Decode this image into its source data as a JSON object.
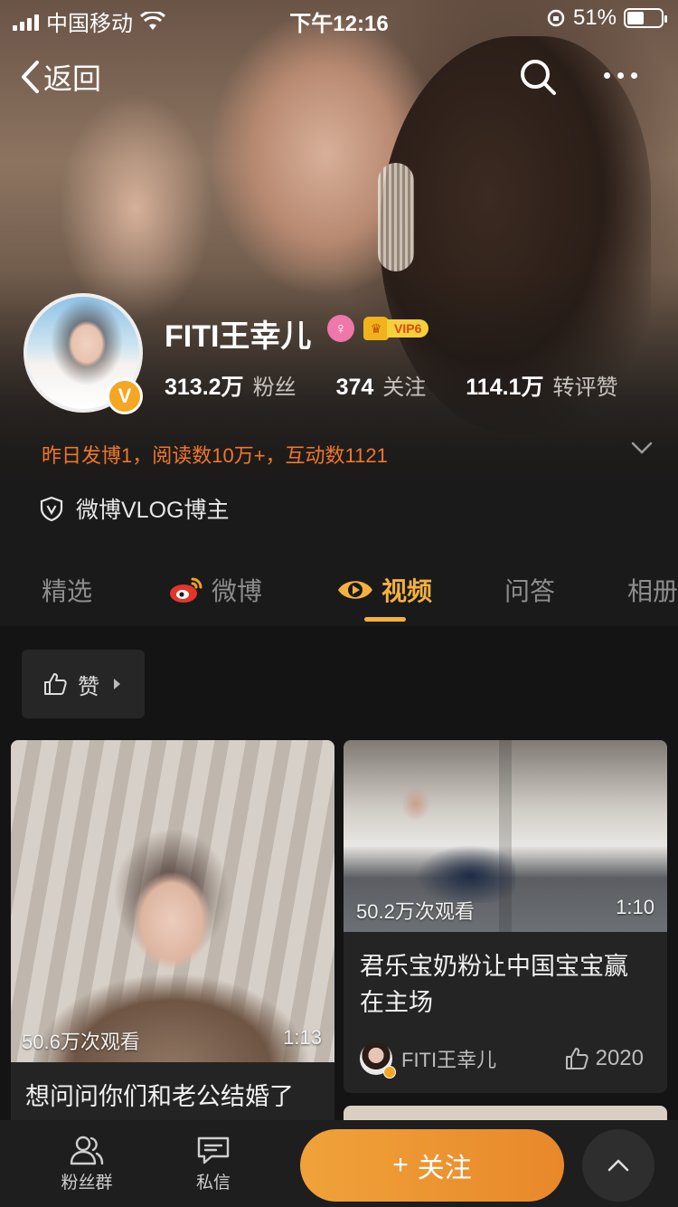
{
  "status_bar": {
    "carrier": "中国移动",
    "time": "下午12:16",
    "battery_percent": "51%",
    "battery_level": 0.51
  },
  "nav": {
    "back_label": "返回"
  },
  "profile": {
    "name": "FITI王幸儿",
    "vip_label": "VIP6",
    "verified_badge": "V",
    "stats": [
      {
        "value": "313.2万",
        "label": "粉丝"
      },
      {
        "value": "374",
        "label": "关注"
      },
      {
        "value": "114.1万",
        "label": "转评赞"
      }
    ],
    "activity_line": "昨日发博1，阅读数10万+，互动数1121",
    "verification": "微博VLOG博主"
  },
  "tabs": [
    {
      "label": "精选",
      "icon": "none",
      "active": false
    },
    {
      "label": "微博",
      "icon": "weibo-logo-icon",
      "active": false
    },
    {
      "label": "视频",
      "icon": "video-eye-icon",
      "active": true
    },
    {
      "label": "问答",
      "icon": "none",
      "active": false
    },
    {
      "label": "相册",
      "icon": "none",
      "active": false
    }
  ],
  "filter": {
    "label": "赞"
  },
  "videos": [
    {
      "views": "50.6万次观看",
      "duration": "1:13",
      "title": "想问问你们和老公结婚了"
    },
    {
      "views": "50.2万次观看",
      "duration": "1:10",
      "title_line1": "君乐宝奶粉让中国宝宝赢",
      "title_line2": "在主场",
      "author": "FITI王幸儿",
      "likes": "2020"
    }
  ],
  "bottom_bar": {
    "fans_group": "粉丝群",
    "messages": "私信",
    "follow": "关注",
    "follow_plus": "+"
  },
  "colors": {
    "accent": "#f4b140",
    "orange_text": "#f0762b",
    "follow_button": "#e8882a",
    "background": "#141414"
  }
}
